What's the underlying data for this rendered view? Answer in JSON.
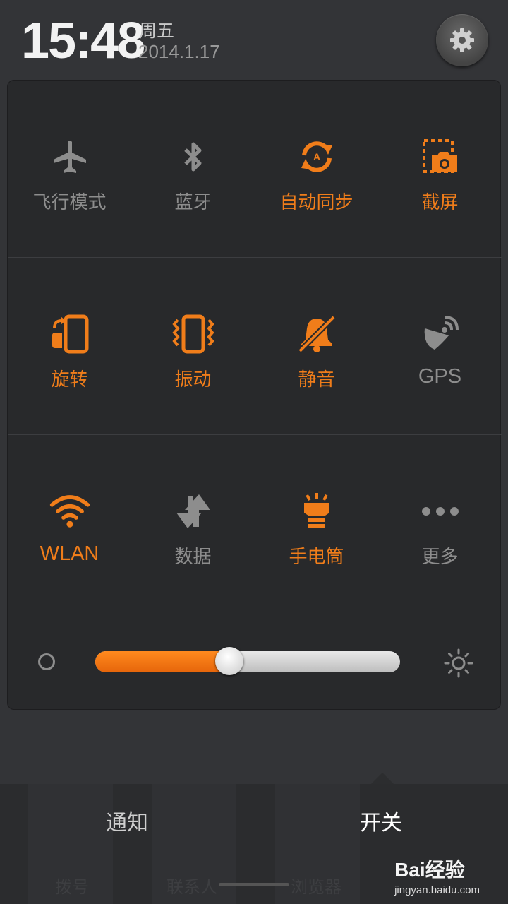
{
  "header": {
    "time": "15:48",
    "weekday": "周五",
    "date": "2014.1.17"
  },
  "colors": {
    "accent": "#f07d1a",
    "inactive": "#8d8d8d",
    "panel": "#28292b"
  },
  "toggles": [
    {
      "label": "飞行模式",
      "icon": "airplane-icon",
      "on": false
    },
    {
      "label": "蓝牙",
      "icon": "bluetooth-icon",
      "on": false
    },
    {
      "label": "自动同步",
      "icon": "auto-sync-icon",
      "on": true
    },
    {
      "label": "截屏",
      "icon": "screenshot-icon",
      "on": false
    },
    {
      "label": "旋转",
      "icon": "rotate-icon",
      "on": true
    },
    {
      "label": "振动",
      "icon": "vibrate-icon",
      "on": true
    },
    {
      "label": "静音",
      "icon": "mute-icon",
      "on": true
    },
    {
      "label": "GPS",
      "icon": "gps-icon",
      "on": false
    },
    {
      "label": "WLAN",
      "icon": "wifi-icon",
      "on": true
    },
    {
      "label": "数据",
      "icon": "data-icon",
      "on": false
    },
    {
      "label": "手电筒",
      "icon": "flashlight-icon",
      "on": true
    },
    {
      "label": "更多",
      "icon": "more-icon",
      "on": false
    }
  ],
  "brightness": {
    "level": 0.44
  },
  "bottom": {
    "tab_notifications": "通知",
    "tab_toggles": "开关",
    "active_tab": "开关",
    "behind_labels": [
      "拨号",
      "联系人",
      "浏览器"
    ]
  },
  "watermark": {
    "logo": "Bai经验",
    "url": "jingyan.baidu.com"
  }
}
